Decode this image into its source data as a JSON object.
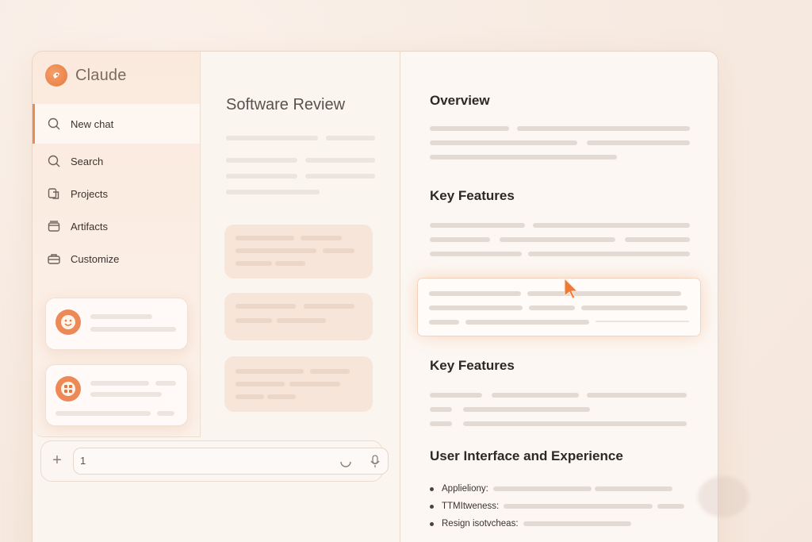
{
  "sidebar": {
    "brand": "Claude",
    "items": [
      {
        "label": "New chat",
        "icon": "search-icon"
      },
      {
        "label": "Search",
        "icon": "search-icon"
      },
      {
        "label": "Projects",
        "icon": "projects-icon"
      },
      {
        "label": "Artifacts",
        "icon": "artifacts-icon"
      },
      {
        "label": "Customize",
        "icon": "customize-icon"
      }
    ]
  },
  "composer": {
    "value": "1"
  },
  "middle": {
    "title": "Software Review"
  },
  "document": {
    "sections": [
      "Overview",
      "Key Features",
      "Key Features",
      "User Interface and Experience"
    ],
    "bullets": [
      "Applieliony:",
      "TTMItweness:",
      "Resign isotvcheas:"
    ]
  },
  "colors": {
    "accent": "#ea8b56",
    "background": "#f7ebe2"
  }
}
